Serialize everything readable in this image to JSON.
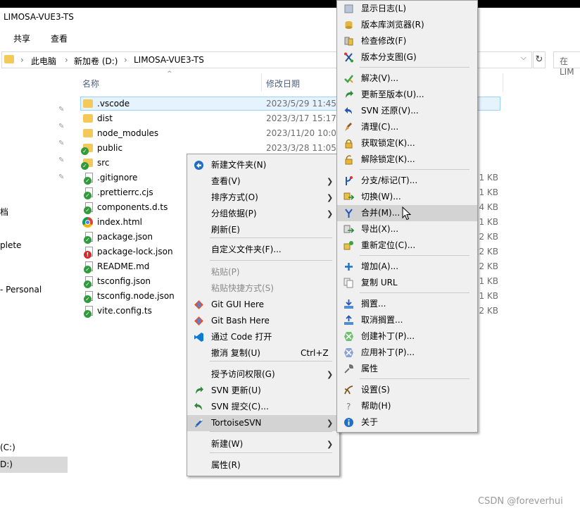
{
  "window": {
    "title": "LIMOSA-VUE3-TS"
  },
  "ribbon": {
    "tabs": [
      "共享",
      "查看"
    ]
  },
  "address": {
    "crumbs": [
      "此电脑",
      "新加卷 (D:)",
      "LIMOSA-VUE3-TS"
    ],
    "search_placeholder": "在 LIM"
  },
  "columns": {
    "name": "名称",
    "date": "修改日期"
  },
  "nav": {
    "items": [
      "档",
      "plete",
      "- Personal",
      "(C:)",
      "D:)"
    ]
  },
  "files": [
    {
      "name": ".vscode",
      "date": "2023/5/29 11:45",
      "size": "",
      "type": "folder"
    },
    {
      "name": "dist",
      "date": "2023/3/17 15:17",
      "size": "",
      "type": "folder"
    },
    {
      "name": "node_modules",
      "date": "2023/11/20 10:09",
      "size": "",
      "type": "folder"
    },
    {
      "name": "public",
      "date": "2023/3/28 11:05",
      "size": "",
      "type": "folder-ok"
    },
    {
      "name": "src",
      "date": "",
      "size": "",
      "type": "folder-ok"
    },
    {
      "name": ".gitignore",
      "date": "",
      "size": "1 KB",
      "type": "doc-ok"
    },
    {
      "name": ".prettierrc.cjs",
      "date": "",
      "size": "1 KB",
      "type": "doc-ok"
    },
    {
      "name": "components.d.ts",
      "date": "",
      "size": "4 KB",
      "type": "doc-ok"
    },
    {
      "name": "index.html",
      "date": "",
      "size": "1 KB",
      "type": "chrome"
    },
    {
      "name": "package.json",
      "date": "",
      "size": "2 KB",
      "type": "doc-ok"
    },
    {
      "name": "package-lock.json",
      "date": "",
      "size": "22 KB",
      "type": "doc-err"
    },
    {
      "name": "README.md",
      "date": "",
      "size": "2 KB",
      "type": "doc-ok"
    },
    {
      "name": "tsconfig.json",
      "date": "",
      "size": "1 KB",
      "type": "doc-ok"
    },
    {
      "name": "tsconfig.node.json",
      "date": "",
      "size": "1 KB",
      "type": "doc-ok"
    },
    {
      "name": "vite.config.ts",
      "date": "",
      "size": "2 KB",
      "type": "doc-ok"
    }
  ],
  "context_menu": {
    "items": [
      {
        "label": "新建文件夹(N)",
        "icon": "new-folder-icon"
      },
      {
        "label": "查看(V)",
        "submenu": true
      },
      {
        "label": "排序方式(O)",
        "submenu": true
      },
      {
        "label": "分组依据(P)",
        "submenu": true
      },
      {
        "label": "刷新(E)"
      },
      {
        "label": "自定义文件夹(F)..."
      },
      {
        "label": "粘贴(P)",
        "disabled": true
      },
      {
        "label": "粘贴快捷方式(S)",
        "disabled": true
      },
      {
        "label": "Git GUI Here",
        "icon": "git-icon"
      },
      {
        "label": "Git Bash Here",
        "icon": "git-icon"
      },
      {
        "label": "通过 Code 打开",
        "icon": "vscode-icon"
      },
      {
        "label": "撤消 复制(U)",
        "shortcut": "Ctrl+Z"
      },
      {
        "label": "授予访问权限(G)",
        "submenu": true
      },
      {
        "label": "SVN 更新(U)",
        "icon": "svn-update-icon"
      },
      {
        "label": "SVN 提交(C)...",
        "icon": "svn-commit-icon"
      },
      {
        "label": "TortoiseSVN",
        "submenu": true,
        "highlighted": true,
        "icon": "tortoisesvn-icon"
      },
      {
        "label": "新建(W)",
        "submenu": true
      },
      {
        "label": "属性(R)"
      }
    ]
  },
  "svn_menu": {
    "items": [
      {
        "label": "显示日志(L)",
        "icon": "log-icon"
      },
      {
        "label": "版本库浏览器(R)",
        "icon": "repo-browser-icon"
      },
      {
        "label": "检查修改(F)",
        "icon": "check-modifications-icon"
      },
      {
        "label": "版本分支图(G)",
        "icon": "revision-graph-icon"
      },
      {
        "label": "解决(V)...",
        "icon": "resolve-icon"
      },
      {
        "label": "更新至版本(U)...",
        "icon": "update-to-revision-icon"
      },
      {
        "label": "SVN 还原(V)...",
        "icon": "revert-icon"
      },
      {
        "label": "清理(C)...",
        "icon": "cleanup-icon"
      },
      {
        "label": "获取锁定(K)...",
        "icon": "lock-icon"
      },
      {
        "label": "解除锁定(K)...",
        "icon": "unlock-icon"
      },
      {
        "label": "分支/标记(T)...",
        "icon": "branch-tag-icon"
      },
      {
        "label": "切换(W)...",
        "icon": "switch-icon"
      },
      {
        "label": "合并(M)...",
        "icon": "merge-icon",
        "highlighted": true
      },
      {
        "label": "导出(X)...",
        "icon": "export-icon"
      },
      {
        "label": "重新定位(C)...",
        "icon": "relocate-icon"
      },
      {
        "label": "增加(A)...",
        "icon": "add-icon"
      },
      {
        "label": "复制 URL",
        "icon": "copy-url-icon"
      },
      {
        "label": "搁置...",
        "icon": "shelve-icon"
      },
      {
        "label": "取消搁置...",
        "icon": "unshelve-icon"
      },
      {
        "label": "创建补丁(P)...",
        "icon": "create-patch-icon"
      },
      {
        "label": "应用补丁(P)...",
        "icon": "apply-patch-icon"
      },
      {
        "label": "属性",
        "icon": "properties-icon"
      },
      {
        "label": "设置(S)",
        "icon": "settings-icon"
      },
      {
        "label": "帮助(H)",
        "icon": "help-icon"
      },
      {
        "label": "关于",
        "icon": "about-icon"
      }
    ]
  },
  "watermark": "CSDN @foreverhui"
}
